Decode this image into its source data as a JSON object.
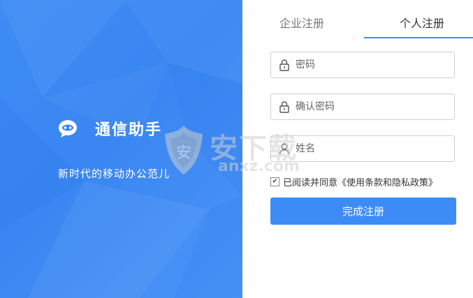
{
  "brand": {
    "name": "通信助手",
    "slogan": "新时代的移动办公范儿"
  },
  "tabs": [
    {
      "label": "企业注册",
      "active": false
    },
    {
      "label": "个人注册",
      "active": true
    }
  ],
  "form": {
    "password_placeholder": "密码",
    "confirm_placeholder": "确认密码",
    "name_placeholder": "姓名",
    "agree_text": "已阅读并同意《使用条款和隐私政策》",
    "agree_checked": true,
    "submit_label": "完成注册"
  },
  "watermark": {
    "title": "安下载",
    "url": "anxz.com"
  },
  "colors": {
    "accent": "#3d8cf5",
    "panel_bg": "#3a86f2"
  },
  "icons": {
    "brand": "chat-bubble-icon",
    "password": "lock-icon",
    "confirm": "lock-icon",
    "name": "user-icon"
  }
}
